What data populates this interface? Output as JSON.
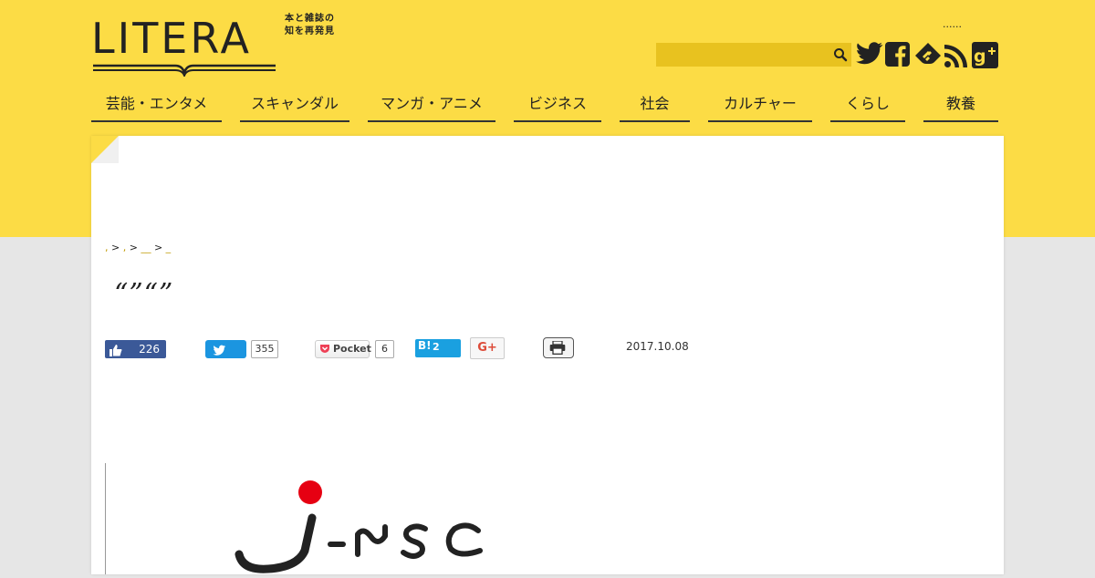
{
  "site": {
    "logo_text": "LITERA",
    "tagline_line1": "本と雑誌の",
    "tagline_line2": "知を再発見",
    "top_dots": "......"
  },
  "search": {
    "placeholder": "",
    "value": ""
  },
  "social_icons": [
    "twitter-icon",
    "facebook-icon",
    "feedly-icon",
    "rss-icon",
    "google-plus-icon"
  ],
  "nav": [
    {
      "label": "芸能・エンタメ"
    },
    {
      "label": "スキャンダル"
    },
    {
      "label": "マンガ・アニメ"
    },
    {
      "label": "ビジネス"
    },
    {
      "label": "社会"
    },
    {
      "label": "カルチャー"
    },
    {
      "label": "くらし"
    },
    {
      "label": "教養"
    }
  ],
  "breadcrumb": {
    "sep": ">",
    "item1": ",",
    "item2": ",",
    "item3": "__",
    "item4": "_"
  },
  "article": {
    "title": "“”“”",
    "date": "2017.10.08",
    "image_text": "J-NSC"
  },
  "share": {
    "facebook_count": "226",
    "twitter_count": "355",
    "pocket_label": "Pocket",
    "pocket_count": "6",
    "hatena_label": "B!",
    "hatena_count": "2",
    "gplus_label": "G+"
  },
  "colors": {
    "brand_yellow": "#fcdc45",
    "search_bg": "#e8c21f",
    "facebook": "#3b5998",
    "twitter": "#1b95e0",
    "hatena": "#1aa0e0",
    "jnsc_red": "#e60012"
  }
}
